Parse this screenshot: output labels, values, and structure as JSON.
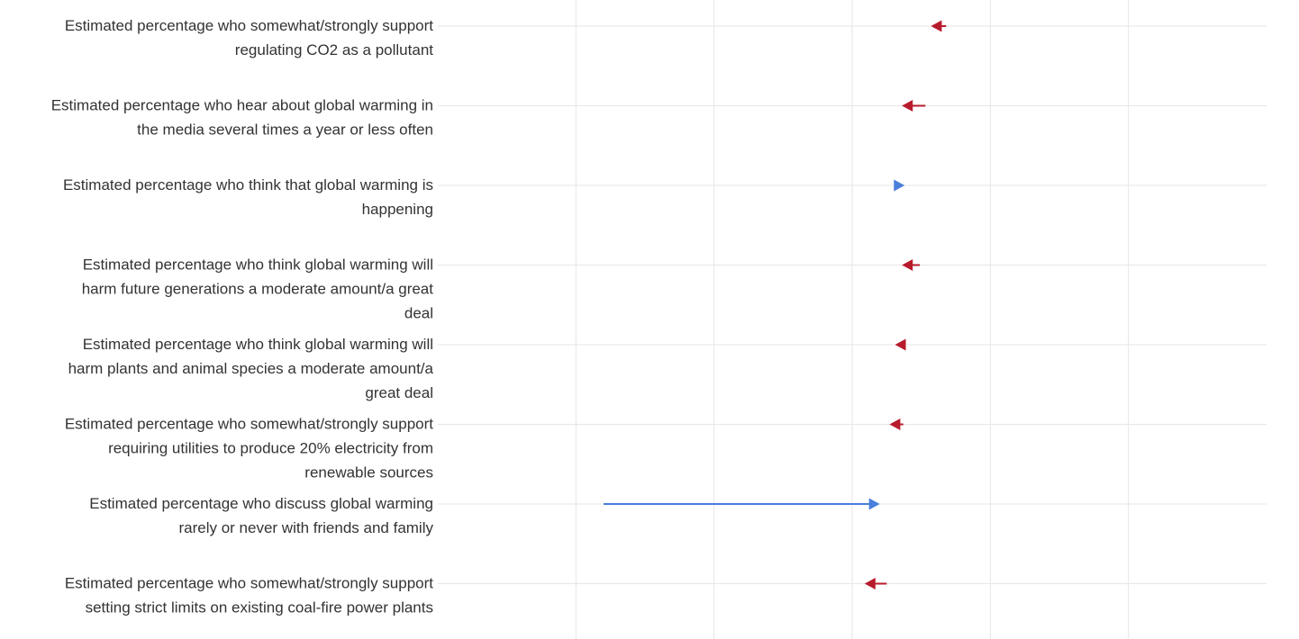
{
  "chart_data": {
    "type": "arrow-range",
    "orientation": "horizontal",
    "xlim": [
      40,
      100
    ],
    "x_gridlines": [
      40,
      50,
      60,
      70,
      80,
      90,
      100
    ],
    "grid": true,
    "increase_color": "#4a7fdb",
    "decrease_color": "#b71c2c",
    "rows": [
      {
        "label_lines": [
          "Estimated percentage who somewhat/strongly support",
          "regulating CO2 as a pollutant"
        ],
        "from": 76.8,
        "to": 75.7
      },
      {
        "label_lines": [
          "Estimated percentage who hear about global warming in",
          "the media several times a year or less often"
        ],
        "from": 75.3,
        "to": 73.6
      },
      {
        "label_lines": [
          "Estimated percentage who think that global warming is",
          "happening"
        ],
        "from": 73.3,
        "to": 73.8
      },
      {
        "label_lines": [
          "Estimated percentage who think global warming will",
          "harm future generations a moderate amount/a great",
          "deal"
        ],
        "from": 74.9,
        "to": 73.6
      },
      {
        "label_lines": [
          "Estimated percentage who think global warming will",
          "harm plants and animal species a moderate amount/a",
          "great deal"
        ],
        "from": 73.8,
        "to": 73.1
      },
      {
        "label_lines": [
          "Estimated percentage who somewhat/strongly support",
          "requiring utilities to produce 20% electricity from",
          "renewable sources"
        ],
        "from": 73.7,
        "to": 72.7
      },
      {
        "label_lines": [
          "Estimated percentage who discuss global warming",
          "rarely or never with friends and family"
        ],
        "from": 52.0,
        "to": 72.0
      },
      {
        "label_lines": [
          "Estimated percentage who somewhat/strongly support",
          "setting strict limits on existing coal-fire power plants"
        ],
        "from": 72.5,
        "to": 70.9
      }
    ]
  }
}
